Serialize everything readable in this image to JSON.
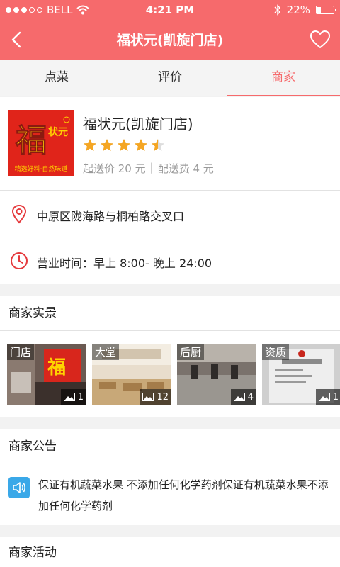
{
  "status_bar": {
    "carrier": "BELL",
    "time": "4:21 PM",
    "battery": "22%"
  },
  "nav": {
    "title": "福状元(凯旋门店)"
  },
  "tabs": [
    {
      "label": "点菜"
    },
    {
      "label": "评价"
    },
    {
      "label": "商家"
    }
  ],
  "shop": {
    "name": "福状元(凯旋门店)",
    "rating": 4.5,
    "min_order": "起送价 20 元",
    "separator": "|",
    "delivery_fee": "配送费 4 元",
    "logo": {
      "main_char": "福",
      "side_text": "状元",
      "slogan": "精选好料·自然味道"
    }
  },
  "address": "中原区陇海路与桐柏路交叉口",
  "hours": "营业时间：早上 8:00- 晚上 24:00",
  "gallery": {
    "title": "商家实景",
    "photos": [
      {
        "label": "门店",
        "count": "1"
      },
      {
        "label": "大堂",
        "count": "12"
      },
      {
        "label": "后厨",
        "count": "4"
      },
      {
        "label": "资质",
        "count": "1"
      }
    ]
  },
  "notice": {
    "title": "商家公告",
    "text": "保证有机蔬菜水果 不添加任何化学药剂保证有机蔬菜水果不添加任何化学药剂"
  },
  "activity": {
    "title": "商家活动"
  },
  "colors": {
    "accent": "#f66a6c",
    "star": "#f5a623",
    "notice_icon": "#3aa8e8"
  }
}
